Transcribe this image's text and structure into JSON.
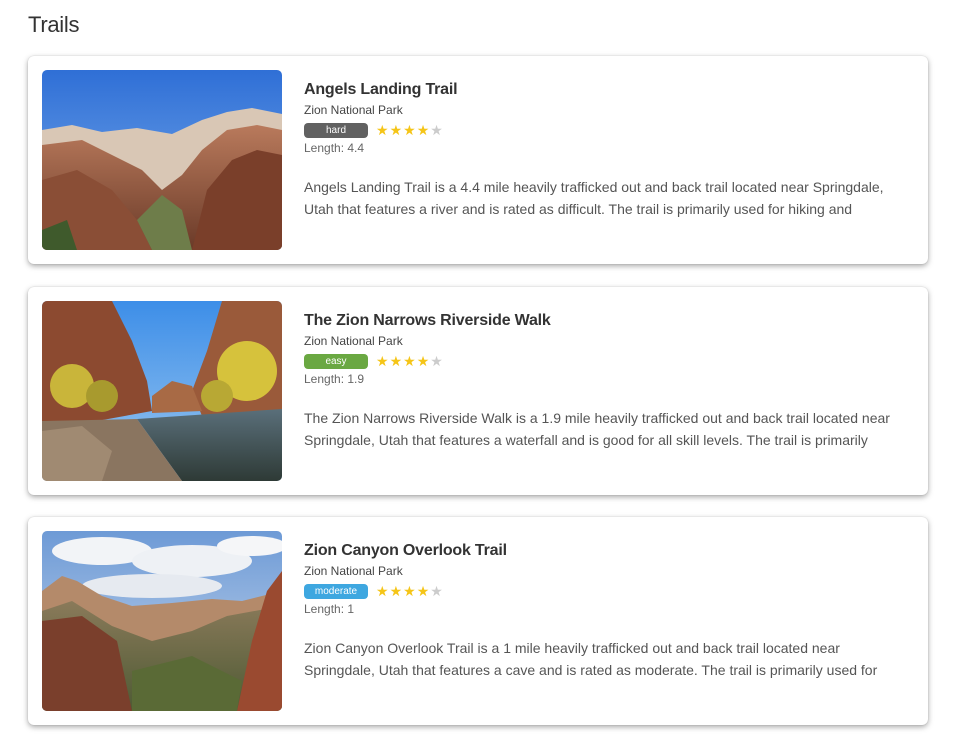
{
  "page": {
    "title": "Trails"
  },
  "colors": {
    "hard": "#616161",
    "easy": "#6aa842",
    "moderate": "#3ea7e0",
    "star_on": "#f5c518",
    "star_off": "#cccccc"
  },
  "trails": [
    {
      "name": "Angels Landing Trail",
      "park": "Zion National Park",
      "difficulty": "hard",
      "rating": 4,
      "rating_max": 5,
      "length": "Length: 4.4",
      "description": "Angels Landing Trail is a 4.4 mile heavily trafficked out and back trail located near Springdale, Utah that features a river and is rated as difficult. The trail is primarily used for hiking and",
      "image": "canyon-overlook-photo"
    },
    {
      "name": "The Zion Narrows Riverside Walk",
      "park": "Zion National Park",
      "difficulty": "easy",
      "rating": 4,
      "rating_max": 5,
      "length": "Length: 1.9",
      "description": "The Zion Narrows Riverside Walk is a 1.9 mile heavily trafficked out and back trail located near Springdale, Utah that features a waterfall and is good for all skill levels. The trail is primarily",
      "image": "river-canyon-photo"
    },
    {
      "name": "Zion Canyon Overlook Trail",
      "park": "Zion National Park",
      "difficulty": "moderate",
      "rating": 4,
      "rating_max": 5,
      "length": "Length: 1",
      "description": "Zion Canyon Overlook Trail is a 1 mile heavily trafficked out and back trail located near Springdale, Utah that features a cave and is rated as moderate. The trail is primarily used for",
      "image": "cloudy-canyon-photo"
    }
  ]
}
